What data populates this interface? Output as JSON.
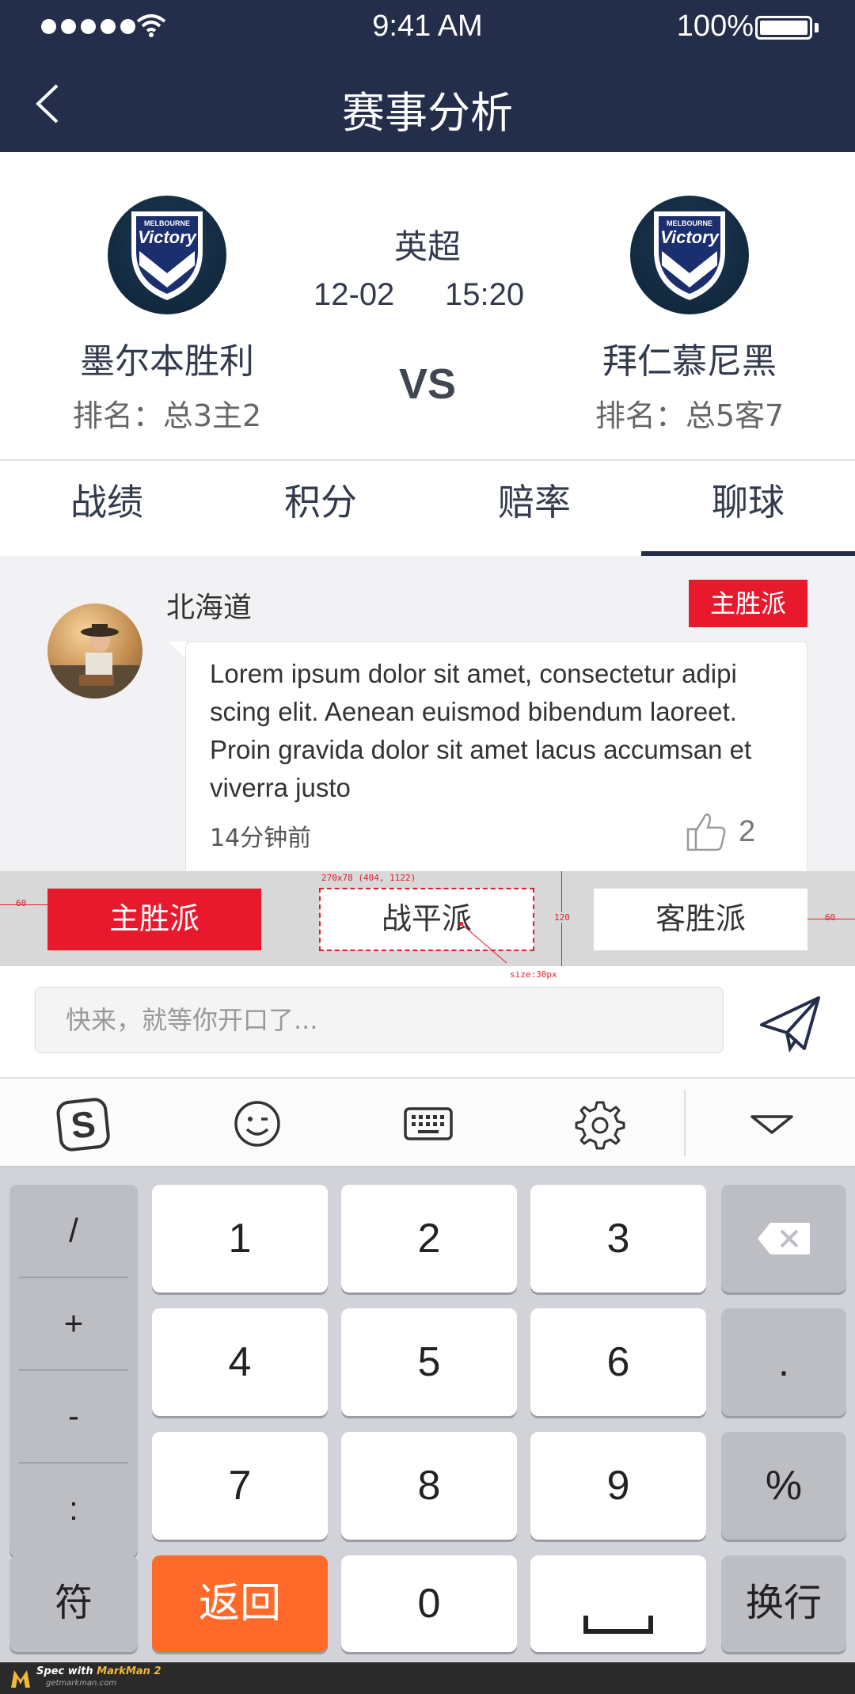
{
  "status_bar": {
    "time": "9:41 AM",
    "battery": "100%"
  },
  "nav": {
    "title": "赛事分析"
  },
  "match": {
    "league": "英超",
    "date": "12-02",
    "time": "15:20",
    "vs": "VS",
    "home": {
      "name": "墨尔本胜利",
      "rank": "排名：总3主2",
      "badge_text": "Victory",
      "badge_top": "MELBOURNE"
    },
    "away": {
      "name": "拜仁慕尼黑",
      "rank": "排名：总5客7",
      "badge_text": "Victory",
      "badge_top": "MELBOURNE"
    }
  },
  "tabs": [
    {
      "label": "战绩"
    },
    {
      "label": "积分"
    },
    {
      "label": "赔率"
    },
    {
      "label": "聊球",
      "active": true
    }
  ],
  "comment": {
    "username": "北海道",
    "stance": "主胜派",
    "message": "Lorem ipsum dolor sit amet, consectetur adipi scing elit. Aenean euismod bibendum laoreet.  Proin gravida dolor sit amet lacus accumsan et viverra justo",
    "time": "14分钟前",
    "likes": "2"
  },
  "stance_options": {
    "home": "主胜派",
    "draw": "战平派",
    "away": "客胜派"
  },
  "spec_annotations": {
    "left_margin": "60",
    "right_margin": "60",
    "box": "270x78 (404, 1122)",
    "height": "120",
    "size": "size:30px"
  },
  "input": {
    "placeholder": "快来，就等你开口了..."
  },
  "keyboard": {
    "symbols": [
      "/",
      "+",
      "-",
      ":"
    ],
    "digits": [
      "1",
      "2",
      "3",
      "4",
      "5",
      "6",
      "7",
      "8",
      "9",
      "0"
    ],
    "dot": ".",
    "percent": "%",
    "fu": "符",
    "back": "返回",
    "enter": "换行"
  },
  "footer": {
    "brand_prefix": "Spec with ",
    "brand": "MarkMan 2",
    "url": "getmarkman.com"
  },
  "colors": {
    "navy": "#242e4a",
    "red": "#e8192c",
    "orange": "#ff6a2b"
  }
}
